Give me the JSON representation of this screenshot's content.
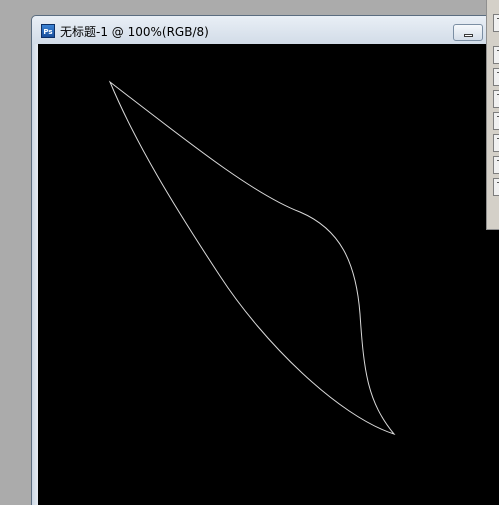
{
  "document": {
    "title": "无标题-1 @ 100%(RGB/8)",
    "app_icon": "ps-icon",
    "app_icon_label": "Ps",
    "canvas_color": "#000000"
  },
  "window_controls": {
    "minimize_icon": "minimize-icon"
  },
  "canvas_path": {
    "stroke_color": "#d9d9d9",
    "shape": "leaf-outline"
  },
  "right_panel": {
    "tool_count": 8
  }
}
